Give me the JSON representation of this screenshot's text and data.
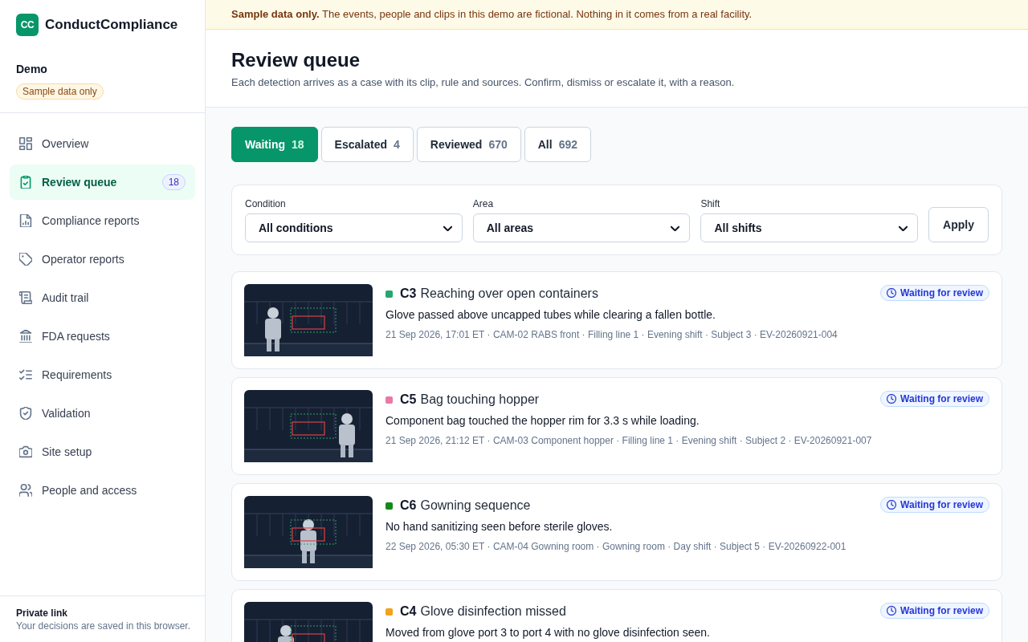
{
  "sidebar": {
    "brand": {
      "logo": "CC",
      "name": "ConductCompliance"
    },
    "workspace": {
      "name": "Demo",
      "badge": "Sample data only"
    },
    "nav": [
      {
        "label": "Overview",
        "selected": false
      },
      {
        "label": "Review queue",
        "selected": true,
        "count": "18"
      },
      {
        "label": "Compliance reports",
        "selected": false
      },
      {
        "label": "Operator reports",
        "selected": false
      },
      {
        "label": "Audit trail",
        "selected": false
      },
      {
        "label": "FDA requests",
        "selected": false
      },
      {
        "label": "Requirements",
        "selected": false
      },
      {
        "label": "Validation",
        "selected": false
      },
      {
        "label": "Site setup",
        "selected": false
      },
      {
        "label": "People and access",
        "selected": false
      }
    ],
    "footer": {
      "title": "Private link",
      "text": "Your decisions are saved in this browser."
    }
  },
  "banner": {
    "text": "**Sample data only.** The events, people and clips in this demo are fictional. Nothing in it comes from a real facility."
  },
  "header": {
    "title": "Review queue",
    "subtitle": "Each detection arrives as a case with its clip, rule and sources. Confirm, dismiss or escalate it, with a reason."
  },
  "tabs": [
    {
      "label": "Waiting",
      "count": "18",
      "selected": true
    },
    {
      "label": "Escalated",
      "count": "4",
      "selected": false
    },
    {
      "label": "Reviewed",
      "count": "670",
      "selected": false
    },
    {
      "label": "All",
      "count": "692",
      "selected": false
    }
  ],
  "filters": {
    "fields": [
      {
        "label": "Condition",
        "value": "All conditions"
      },
      {
        "label": "Area",
        "value": "All areas"
      },
      {
        "label": "Shift",
        "value": "All shifts"
      }
    ],
    "apply": "Apply"
  },
  "cases": [
    {
      "id": "C3",
      "title": "Reaching over open containers",
      "color": "#27a571",
      "description": "Glove passed above uncapped tubes while clearing a fallen bottle.",
      "meta": "21 Sep 2026, 17:01 ET · CAM-02 RABS front · Filling line 1 · Evening shift · Subject 3 · EV-20260921-004",
      "status": "Waiting for review"
    },
    {
      "id": "C5",
      "title": "Bag touching hopper",
      "color": "#e879a6",
      "description": "Component bag touched the hopper rim for 3.3 s while loading.",
      "meta": "21 Sep 2026, 21:12 ET · CAM-03 Component hopper · Filling line 1 · Evening shift · Subject 2 · EV-20260921-007",
      "status": "Waiting for review"
    },
    {
      "id": "C6",
      "title": "Gowning sequence",
      "color": "#15891c",
      "description": "No hand sanitizing seen before sterile gloves.",
      "meta": "22 Sep 2026, 05:30 ET · CAM-04 Gowning room · Gowning room · Day shift · Subject 5 · EV-20260922-001",
      "status": "Waiting for review"
    },
    {
      "id": "C4",
      "title": "Glove disinfection missed",
      "color": "#f2a31b",
      "description": "Moved from glove port 3 to port 4 with no glove disinfection seen.",
      "status": "Waiting for review"
    }
  ]
}
